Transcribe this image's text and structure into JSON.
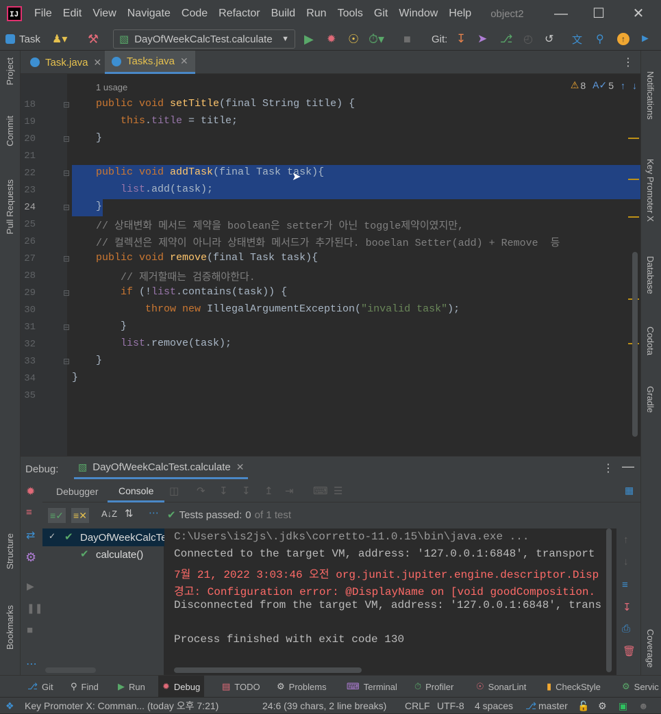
{
  "menubar": {
    "logo": "IJ",
    "items": [
      "File",
      "Edit",
      "View",
      "Navigate",
      "Code",
      "Refactor",
      "Build",
      "Run",
      "Tools",
      "Git",
      "Window",
      "Help"
    ],
    "project_name": "object2"
  },
  "toolbar": {
    "task_label": "Task",
    "run_config": "DayOfWeekCalcTest.calculate",
    "git_label": "Git:"
  },
  "tabs": [
    {
      "label": "Task.java"
    },
    {
      "label": "Tasks.java"
    }
  ],
  "left_strip": {
    "project": "Project",
    "commit": "Commit",
    "pull_requests": "Pull Requests",
    "structure": "Structure",
    "bookmarks": "Bookmarks"
  },
  "right_strip": {
    "notifications": "Notifications",
    "key_promoter": "Key Promoter X",
    "database": "Database",
    "codota": "Codota",
    "gradle": "Gradle",
    "coverage": "Coverage"
  },
  "editor": {
    "usage_hint": "1 usage",
    "warnings": "8",
    "typos": "5",
    "line_numbers": [
      "18",
      "19",
      "20",
      "21",
      "22",
      "23",
      "24",
      "25",
      "26",
      "27",
      "28",
      "29",
      "30",
      "31",
      "32",
      "33",
      "34",
      "35"
    ],
    "lines": {
      "l18a": "public void ",
      "l18b": "setTitle",
      "l18c": "(final String title) {",
      "l19a": "this",
      "l19b": ".",
      "l19c": "title",
      "l19d": " = title;",
      "l20": "}",
      "l22a": "public void ",
      "l22b": "addTask",
      "l22c": "(final Task task){",
      "l23a": "list",
      "l23b": ".add(task);",
      "l24": "}",
      "l25": "// 상태변화 메서드 제약을 boolean은 setter가 아닌 toggle제약이였지만,",
      "l26": "// 컬렉션은 제약이 아니라 상태변화 메서드가 추가된다. booelan Setter(add) + Remove  등",
      "l27a": "public void ",
      "l27b": "remove",
      "l27c": "(final Task task){",
      "l28": "// 제거할때는 검증해야한다.",
      "l29a": "if",
      "l29b": " (!",
      "l29c": "list",
      "l29d": ".contains(task)) {",
      "l30a": "throw new ",
      "l30b": "IllegalArgumentException(",
      "l30c": "\"invalid task\"",
      "l30d": ");",
      "l31": "}",
      "l32a": "list",
      "l32b": ".remove(task);",
      "l33": "}",
      "l34": "}"
    }
  },
  "debug": {
    "label": "Debug:",
    "session": "DayOfWeekCalcTest.calculate",
    "tab_debugger": "Debugger",
    "tab_console": "Console",
    "tests_passed_label": "Tests passed:",
    "tests_passed_count": "0",
    "tests_of": "of 1 test",
    "tree_root": "DayOfWeekCalcTe",
    "tree_child": "calculate()",
    "console_lines": [
      "C:\\Users\\is2js\\.jdks\\corretto-11.0.15\\bin\\java.exe ...",
      "Connected to the target VM, address: '127.0.0.1:6848', transport",
      "7월 21, 2022 3:03:46 오전 org.junit.jupiter.engine.descriptor.Disp",
      "경고: Configuration error: @DisplayName on [void goodComposition.",
      "Disconnected from the target VM, address: '127.0.0.1:6848', trans",
      "",
      "Process finished with exit code 130"
    ]
  },
  "bottom_tools": [
    "Git",
    "Find",
    "Run",
    "Debug",
    "TODO",
    "Problems",
    "Terminal",
    "Profiler",
    "SonarLint",
    "CheckStyle",
    "Servic"
  ],
  "status": {
    "message": "Key Promoter X: Comman... (today 오후 7:21)",
    "position": "24:6 (39 chars, 2 line breaks)",
    "line_sep": "CRLF",
    "encoding": "UTF-8",
    "indent": "4 spaces",
    "branch": "master"
  },
  "colors": {
    "accent": "#4a88c7",
    "selection": "#214283",
    "error": "#ff6b68",
    "keyword": "#cc7832",
    "string": "#6a8759"
  }
}
